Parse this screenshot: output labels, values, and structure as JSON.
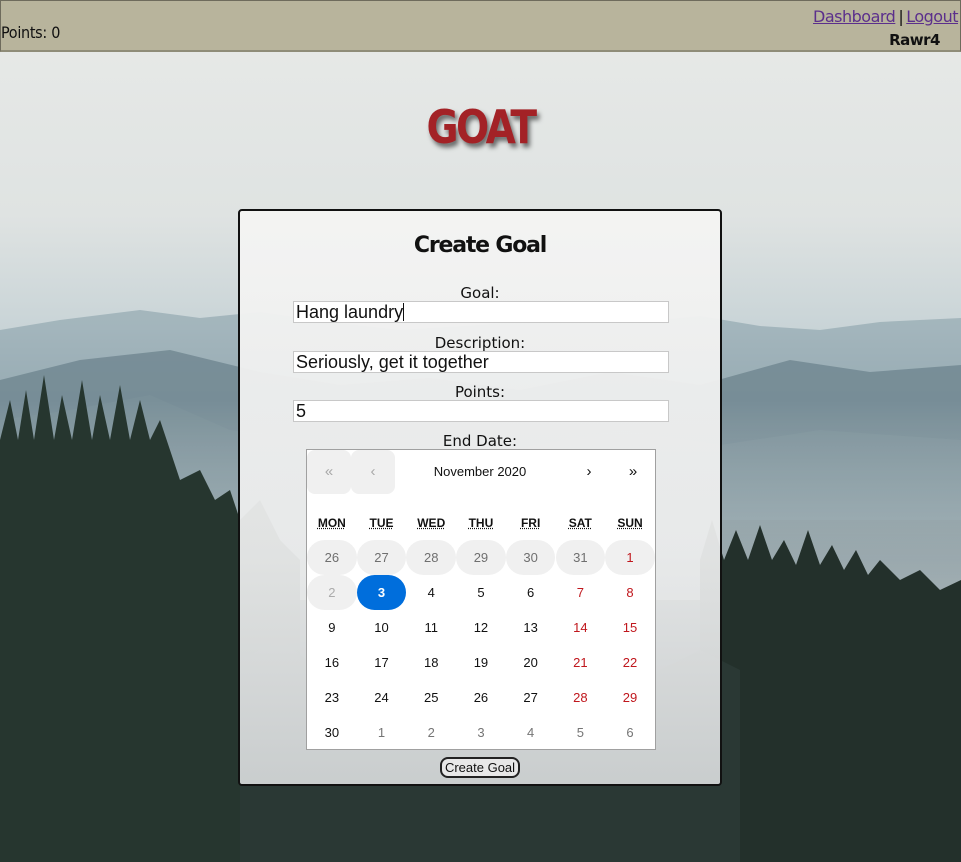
{
  "header": {
    "points_text": "Points: 0",
    "dashboard_link": "Dashboard",
    "separator": "|",
    "logout_link": "Logout",
    "username": "Rawr4"
  },
  "logo_text": "GOAT",
  "form": {
    "title": "Create Goal",
    "goal_label": "Goal:",
    "goal_value": "Hang laundry",
    "description_label": "Description:",
    "description_value": "Seriously, get it together",
    "points_label": "Points:",
    "points_value": "5",
    "end_date_label": "End Date:",
    "submit_label": "Create Goal"
  },
  "calendar": {
    "nav": {
      "prev_year": "«",
      "prev_month": "‹",
      "next_month": "›",
      "next_year": "»"
    },
    "month_label": "November 2020",
    "weekdays": [
      "MON",
      "TUE",
      "WED",
      "THU",
      "FRI",
      "SAT",
      "SUN"
    ],
    "selected_day": "3",
    "weeks": [
      [
        {
          "d": "26",
          "state": "disabled"
        },
        {
          "d": "27",
          "state": "disabled"
        },
        {
          "d": "28",
          "state": "disabled"
        },
        {
          "d": "29",
          "state": "disabled"
        },
        {
          "d": "30",
          "state": "disabled"
        },
        {
          "d": "31",
          "state": "disabled"
        },
        {
          "d": "1",
          "state": "disabled-weekend"
        }
      ],
      [
        {
          "d": "2",
          "state": "disabled-faint"
        },
        {
          "d": "3",
          "state": "selected"
        },
        {
          "d": "4",
          "state": "normal"
        },
        {
          "d": "5",
          "state": "normal"
        },
        {
          "d": "6",
          "state": "normal"
        },
        {
          "d": "7",
          "state": "weekend"
        },
        {
          "d": "8",
          "state": "weekend"
        }
      ],
      [
        {
          "d": "9",
          "state": "normal"
        },
        {
          "d": "10",
          "state": "normal"
        },
        {
          "d": "11",
          "state": "normal"
        },
        {
          "d": "12",
          "state": "normal"
        },
        {
          "d": "13",
          "state": "normal"
        },
        {
          "d": "14",
          "state": "weekend"
        },
        {
          "d": "15",
          "state": "weekend"
        }
      ],
      [
        {
          "d": "16",
          "state": "normal"
        },
        {
          "d": "17",
          "state": "normal"
        },
        {
          "d": "18",
          "state": "normal"
        },
        {
          "d": "19",
          "state": "normal"
        },
        {
          "d": "20",
          "state": "normal"
        },
        {
          "d": "21",
          "state": "weekend"
        },
        {
          "d": "22",
          "state": "weekend"
        }
      ],
      [
        {
          "d": "23",
          "state": "normal"
        },
        {
          "d": "24",
          "state": "normal"
        },
        {
          "d": "25",
          "state": "normal"
        },
        {
          "d": "26",
          "state": "normal"
        },
        {
          "d": "27",
          "state": "normal"
        },
        {
          "d": "28",
          "state": "weekend"
        },
        {
          "d": "29",
          "state": "weekend"
        }
      ],
      [
        {
          "d": "30",
          "state": "normal"
        },
        {
          "d": "1",
          "state": "neighbor"
        },
        {
          "d": "2",
          "state": "neighbor"
        },
        {
          "d": "3",
          "state": "neighbor"
        },
        {
          "d": "4",
          "state": "neighbor"
        },
        {
          "d": "5",
          "state": "neighbor"
        },
        {
          "d": "6",
          "state": "neighbor"
        }
      ]
    ]
  },
  "colors": {
    "header_bg": "#b8b49c",
    "logo": "#a32226",
    "link": "#5b2f8c",
    "weekend": "#c0171d",
    "selected": "#006edc"
  }
}
